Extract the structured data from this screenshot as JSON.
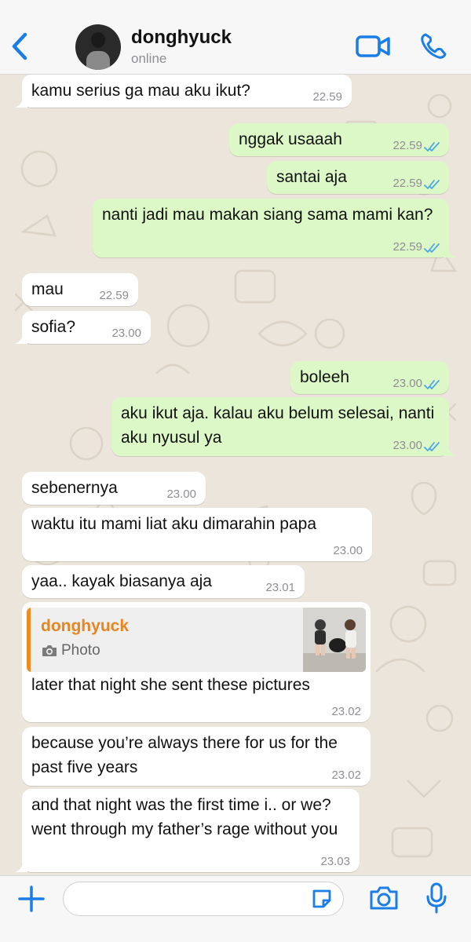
{
  "header": {
    "contact_name": "donghyuck",
    "status": "online"
  },
  "colors": {
    "accent": "#1a7ee6",
    "incoming_bubble": "#ffffff",
    "outgoing_bubble": "#dcf8c6",
    "read_ticks": "#4fa6e6",
    "reply_accent": "#f08a24"
  },
  "messages": [
    {
      "dir": "in",
      "text": "kamu serius ga mau aku ikut?",
      "time": "22.59"
    },
    {
      "dir": "out",
      "text": "nggak usaaah",
      "time": "22.59",
      "read": true
    },
    {
      "dir": "out",
      "text": "santai aja",
      "time": "22.59",
      "read": true
    },
    {
      "dir": "out",
      "text": "nanti jadi mau makan siang sama mami kan?",
      "time": "22.59",
      "read": true
    },
    {
      "dir": "in",
      "text": "mau",
      "time": "22.59"
    },
    {
      "dir": "in",
      "text": "sofia?",
      "time": "23.00"
    },
    {
      "dir": "out",
      "text": "boleeh",
      "time": "23.00",
      "read": true
    },
    {
      "dir": "out",
      "text": "aku ikut aja. kalau aku belum selesai, nanti aku nyusul ya",
      "time": "23.00",
      "read": true
    },
    {
      "dir": "in",
      "text": "sebenernya",
      "time": "23.00"
    },
    {
      "dir": "in",
      "text": "waktu itu mami liat aku dimarahin papa",
      "time": "23.00"
    },
    {
      "dir": "in",
      "text": "yaa.. kayak biasanya aja",
      "time": "23.01"
    },
    {
      "dir": "in",
      "text": "later that night she sent these pictures",
      "time": "23.02",
      "reply": {
        "name": "donghyuck",
        "type": "Photo"
      }
    },
    {
      "dir": "in",
      "text": "because you’re always there for us for the past five years",
      "time": "23.02"
    },
    {
      "dir": "in",
      "text": "and that night was the first time i.. or we? went through my father’s rage without you",
      "time": "23.03"
    }
  ],
  "composer": {
    "value": "",
    "placeholder": ""
  },
  "icons": [
    "back-chevron-icon",
    "video-call-icon",
    "phone-icon",
    "plus-icon",
    "sticker-icon",
    "camera-icon",
    "mic-icon",
    "read-ticks-icon"
  ]
}
